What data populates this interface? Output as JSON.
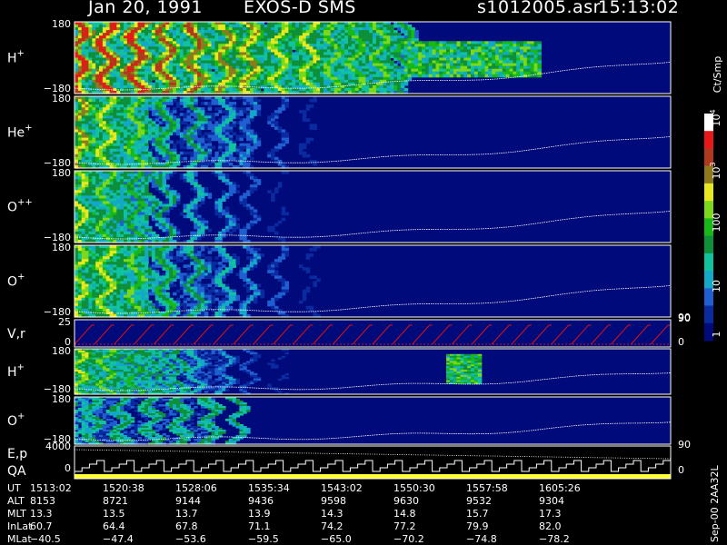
{
  "header": {
    "date": "Jan 20, 1991",
    "instrument": "EXOS-D SMS",
    "file": "s1012005.asr",
    "time": "15:13:02"
  },
  "colorbar": {
    "title": "Ct/Smp",
    "tick_labels": [
      "1",
      "10",
      "100",
      "10",
      "10"
    ],
    "tick_exponents": [
      "",
      "",
      "",
      "3",
      "4"
    ]
  },
  "footer": {
    "rows": [
      {
        "label": "UT",
        "values": [
          "1513:02",
          "1520:38",
          "1528:06",
          "1535:34",
          "1543:02",
          "1550:30",
          "1557:58",
          "1605:26"
        ]
      },
      {
        "label": "ALT",
        "values": [
          "8153",
          "8721",
          "9144",
          "9436",
          "9598",
          "9630",
          "9532",
          "9304"
        ]
      },
      {
        "label": "MLT",
        "values": [
          "13.3",
          "13.5",
          "13.7",
          "13.9",
          "14.3",
          "14.8",
          "15.7",
          "17.3"
        ]
      },
      {
        "label": "InLat",
        "values": [
          "60.7",
          "64.4",
          "67.8",
          "71.1",
          "74.2",
          "77.2",
          "79.9",
          "82.0"
        ]
      },
      {
        "label": "MLat",
        "values": [
          "−40.5",
          "−47.4",
          "−53.6",
          "−59.5",
          "−65.0",
          "−70.2",
          "−74.8",
          "−78.2"
        ]
      }
    ],
    "stamp": "Sep-00  2AA32L"
  },
  "chart_data": [
    {
      "type": "heatmap",
      "panel": "H+",
      "ion": "H",
      "charge": "+",
      "ylim": [
        -180,
        180
      ],
      "tick_labels": [
        "180",
        "−180"
      ]
    },
    {
      "type": "heatmap",
      "panel": "He+",
      "ion": "He",
      "charge": "+",
      "ylim": [
        -180,
        180
      ],
      "tick_labels": [
        "180",
        "−180"
      ]
    },
    {
      "type": "heatmap",
      "panel": "O++",
      "ion": "O",
      "charge": "++",
      "ylim": [
        -180,
        180
      ],
      "tick_labels": [
        "180",
        "−180"
      ]
    },
    {
      "type": "heatmap",
      "panel": "O+",
      "ion": "O",
      "charge": "+",
      "ylim": [
        -180,
        180
      ],
      "tick_labels": [
        "180",
        "−180"
      ],
      "right_tick": "90"
    },
    {
      "type": "line",
      "panel": "V,r",
      "ylim": [
        0,
        25
      ],
      "tick_labels": [
        "25",
        "0"
      ],
      "right_ticks": [
        "90",
        "0"
      ]
    },
    {
      "type": "heatmap",
      "panel": "H+ (lower)",
      "ion": "H",
      "charge": "+",
      "ylim": [
        -180,
        180
      ],
      "tick_labels": [
        "180",
        "−180"
      ]
    },
    {
      "type": "heatmap",
      "panel": "O+ (lower)",
      "ion": "O",
      "charge": "+",
      "ylim": [
        -180,
        180
      ],
      "tick_labels": [
        "180",
        "−180"
      ],
      "right_tick": "90"
    },
    {
      "type": "line",
      "panel": "E,p QA",
      "labels": [
        "E,p",
        "QA"
      ],
      "ylim": [
        0,
        4000
      ],
      "tick_labels": [
        "4000",
        "0"
      ],
      "right_tick": "0"
    }
  ]
}
